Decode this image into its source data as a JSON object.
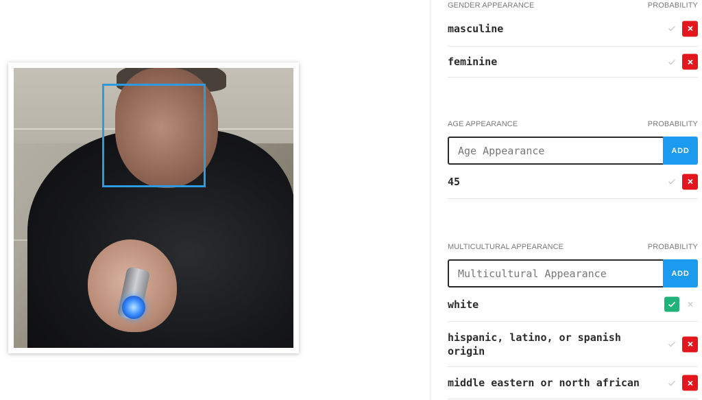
{
  "gender": {
    "header": "GENDER APPEARANCE",
    "probability_label": "PROBABILITY",
    "items": [
      {
        "label": "masculine",
        "state": "rejected"
      },
      {
        "label": "feminine",
        "state": "rejected"
      }
    ]
  },
  "age": {
    "header": "AGE APPEARANCE",
    "probability_label": "PROBABILITY",
    "input_placeholder": "Age Appearance",
    "add_label": "ADD",
    "items": [
      {
        "label": "45",
        "state": "rejected"
      }
    ]
  },
  "multicultural": {
    "header": "MULTICULTURAL APPEARANCE",
    "probability_label": "PROBABILITY",
    "input_placeholder": "Multicultural Appearance",
    "add_label": "ADD",
    "items": [
      {
        "label": "white",
        "state": "accepted"
      },
      {
        "label": "hispanic, latino, or spanish origin",
        "state": "rejected"
      },
      {
        "label": "middle eastern or north african",
        "state": "rejected"
      }
    ]
  },
  "colors": {
    "accept_green": "#21b27a",
    "reject_red": "#e4161d",
    "add_blue": "#1a9bf0",
    "face_box_blue": "#2d9be4"
  },
  "icons": [
    "check-icon",
    "close-icon"
  ]
}
